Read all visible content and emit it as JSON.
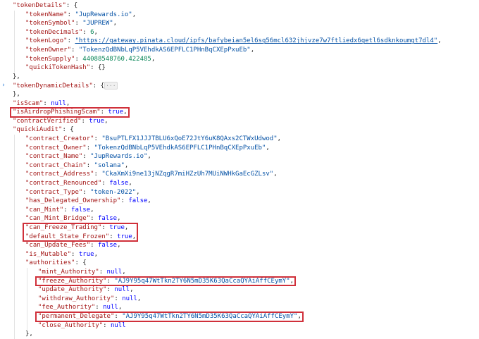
{
  "lines": [
    {
      "indent": 1,
      "toks": [
        [
          "k",
          "\"tokenDetails\""
        ],
        [
          "p",
          ": {"
        ]
      ]
    },
    {
      "indent": 2,
      "toks": [
        [
          "k",
          "\"tokenName\""
        ],
        [
          "p",
          ": "
        ],
        [
          "s",
          "\"JupRewards.io\""
        ],
        [
          "p",
          ","
        ]
      ]
    },
    {
      "indent": 2,
      "toks": [
        [
          "k",
          "\"tokenSymbol\""
        ],
        [
          "p",
          ": "
        ],
        [
          "s",
          "\"JUPREW\""
        ],
        [
          "p",
          ","
        ]
      ]
    },
    {
      "indent": 2,
      "toks": [
        [
          "k",
          "\"tokenDecimals\""
        ],
        [
          "p",
          ": "
        ],
        [
          "n",
          "6"
        ],
        [
          "p",
          ","
        ]
      ]
    },
    {
      "indent": 2,
      "toks": [
        [
          "k",
          "\"tokenLogo\""
        ],
        [
          "p",
          ": "
        ],
        [
          "u",
          "\"https://gateway.pinata.cloud/ipfs/bafybeian5el6sg56mcl632jhjvze7w7ftliedx6getl6sdknkoumgt7dl4\""
        ],
        [
          "p",
          ","
        ]
      ]
    },
    {
      "indent": 2,
      "toks": [
        [
          "k",
          "\"tokenOwner\""
        ],
        [
          "p",
          ": "
        ],
        [
          "s",
          "\"TokenzQdBNbLqP5VEhdkAS6EPFLC1PHnBqCXEpPxuEb\""
        ],
        [
          "p",
          ","
        ]
      ]
    },
    {
      "indent": 2,
      "toks": [
        [
          "k",
          "\"tokenSupply\""
        ],
        [
          "p",
          ": "
        ],
        [
          "n",
          "44088548760.422485"
        ],
        [
          "p",
          ","
        ]
      ]
    },
    {
      "indent": 2,
      "toks": [
        [
          "k",
          "\"quickiTokenHash\""
        ],
        [
          "p",
          ": {}"
        ]
      ]
    },
    {
      "indent": 1,
      "toks": [
        [
          "p",
          "},"
        ]
      ]
    },
    {
      "indent": 1,
      "fold": true,
      "toks": [
        [
          "k",
          "\"tokenDynamicDetails\""
        ],
        [
          "p",
          ": {"
        ],
        [
          "fc",
          "···"
        ]
      ]
    },
    {
      "indent": 1,
      "toks": [
        [
          "p",
          "},"
        ]
      ]
    },
    {
      "indent": 1,
      "toks": [
        [
          "k",
          "\"isScam\""
        ],
        [
          "p",
          ": "
        ],
        [
          "l",
          "null"
        ],
        [
          "p",
          ","
        ]
      ]
    },
    {
      "indent": 1,
      "toks": [
        [
          "k",
          "\"isAirdropPhishingScam\""
        ],
        [
          "p",
          ": "
        ],
        [
          "l",
          "true"
        ],
        [
          "p",
          ","
        ]
      ]
    },
    {
      "indent": 1,
      "toks": [
        [
          "k",
          "\"contractVerified\""
        ],
        [
          "p",
          ": "
        ],
        [
          "l",
          "true"
        ],
        [
          "p",
          ","
        ]
      ]
    },
    {
      "indent": 1,
      "toks": [
        [
          "k",
          "\"quickiAudit\""
        ],
        [
          "p",
          ": {"
        ]
      ]
    },
    {
      "indent": 2,
      "toks": [
        [
          "k",
          "\"contract_Creator\""
        ],
        [
          "p",
          ": "
        ],
        [
          "s",
          "\"BsuPTLFX1JJJTBLU6xQoE72JtY6uK8QAxs2CTWxUdwod\""
        ],
        [
          "p",
          ","
        ]
      ]
    },
    {
      "indent": 2,
      "toks": [
        [
          "k",
          "\"contract_Owner\""
        ],
        [
          "p",
          ": "
        ],
        [
          "s",
          "\"TokenzQdBNbLqP5VEhdkAS6EPFLC1PHnBqCXEpPxuEb\""
        ],
        [
          "p",
          ","
        ]
      ]
    },
    {
      "indent": 2,
      "toks": [
        [
          "k",
          "\"contract_Name\""
        ],
        [
          "p",
          ": "
        ],
        [
          "s",
          "\"JupRewards.io\""
        ],
        [
          "p",
          ","
        ]
      ]
    },
    {
      "indent": 2,
      "toks": [
        [
          "k",
          "\"contract_Chain\""
        ],
        [
          "p",
          ": "
        ],
        [
          "s",
          "\"solana\""
        ],
        [
          "p",
          ","
        ]
      ]
    },
    {
      "indent": 2,
      "toks": [
        [
          "k",
          "\"contract_Address\""
        ],
        [
          "p",
          ": "
        ],
        [
          "s",
          "\"CkaXmXi9ne13jNZqgR7miHZzUh7MUiNWHkGaEcGZLsv\""
        ],
        [
          "p",
          ","
        ]
      ]
    },
    {
      "indent": 2,
      "toks": [
        [
          "k",
          "\"contract_Renounced\""
        ],
        [
          "p",
          ": "
        ],
        [
          "l",
          "false"
        ],
        [
          "p",
          ","
        ]
      ]
    },
    {
      "indent": 2,
      "toks": [
        [
          "k",
          "\"contract_Type\""
        ],
        [
          "p",
          ": "
        ],
        [
          "s",
          "\"token-2022\""
        ],
        [
          "p",
          ","
        ]
      ]
    },
    {
      "indent": 2,
      "toks": [
        [
          "k",
          "\"has_Delegated_Ownership\""
        ],
        [
          "p",
          ": "
        ],
        [
          "l",
          "false"
        ],
        [
          "p",
          ","
        ]
      ]
    },
    {
      "indent": 2,
      "toks": [
        [
          "k",
          "\"can_Mint\""
        ],
        [
          "p",
          ": "
        ],
        [
          "l",
          "false"
        ],
        [
          "p",
          ","
        ]
      ]
    },
    {
      "indent": 2,
      "toks": [
        [
          "k",
          "\"can_Mint_Bridge\""
        ],
        [
          "p",
          ": "
        ],
        [
          "l",
          "false"
        ],
        [
          "p",
          ","
        ]
      ]
    },
    {
      "indent": 2,
      "toks": [
        [
          "k",
          "\"can_Freeze_Trading\""
        ],
        [
          "p",
          ": "
        ],
        [
          "l",
          "true"
        ],
        [
          "p",
          ","
        ]
      ]
    },
    {
      "indent": 2,
      "toks": [
        [
          "k",
          "\"default_State_Frozen\""
        ],
        [
          "p",
          ": "
        ],
        [
          "l",
          "true"
        ],
        [
          "p",
          ","
        ]
      ]
    },
    {
      "indent": 2,
      "toks": [
        [
          "k",
          "\"can_Update_Fees\""
        ],
        [
          "p",
          ": "
        ],
        [
          "l",
          "false"
        ],
        [
          "p",
          ","
        ]
      ]
    },
    {
      "indent": 2,
      "toks": [
        [
          "k",
          "\"is_Mutable\""
        ],
        [
          "p",
          ": "
        ],
        [
          "l",
          "true"
        ],
        [
          "p",
          ","
        ]
      ]
    },
    {
      "indent": 2,
      "toks": [
        [
          "k",
          "\"authorities\""
        ],
        [
          "p",
          ": {"
        ]
      ]
    },
    {
      "indent": 3,
      "toks": [
        [
          "k",
          "\"mint_Authority\""
        ],
        [
          "p",
          ": "
        ],
        [
          "l",
          "null"
        ],
        [
          "p",
          ","
        ]
      ]
    },
    {
      "indent": 3,
      "toks": [
        [
          "k",
          "\"freeze_Authority\""
        ],
        [
          "p",
          ": "
        ],
        [
          "s",
          "\"AJ9Y95q47WtTkn2TY6N5mD35K63QaCcaQYAiAffCEymY\""
        ],
        [
          "p",
          ","
        ]
      ]
    },
    {
      "indent": 3,
      "toks": [
        [
          "k",
          "\"update_Authority\""
        ],
        [
          "p",
          ": "
        ],
        [
          "l",
          "null"
        ],
        [
          "p",
          ","
        ]
      ]
    },
    {
      "indent": 3,
      "toks": [
        [
          "k",
          "\"withdraw_Authority\""
        ],
        [
          "p",
          ": "
        ],
        [
          "l",
          "null"
        ],
        [
          "p",
          ","
        ]
      ]
    },
    {
      "indent": 3,
      "toks": [
        [
          "k",
          "\"fee_Authority\""
        ],
        [
          "p",
          ": "
        ],
        [
          "l",
          "null"
        ],
        [
          "p",
          ","
        ]
      ]
    },
    {
      "indent": 3,
      "toks": [
        [
          "k",
          "\"permanent_Delegate\""
        ],
        [
          "p",
          ": "
        ],
        [
          "s",
          "\"AJ9Y95q47WtTkn2TY6N5mD35K63QaCcaQYAiAffCEymY\""
        ],
        [
          "p",
          ","
        ]
      ]
    },
    {
      "indent": 3,
      "toks": [
        [
          "k",
          "\"close_Authority\""
        ],
        [
          "p",
          ": "
        ],
        [
          "l",
          "null"
        ]
      ]
    },
    {
      "indent": 2,
      "toks": [
        [
          "p",
          "},"
        ]
      ]
    }
  ],
  "highlights": [
    {
      "from": 12,
      "to": 12
    },
    {
      "from": 25,
      "to": 26
    },
    {
      "from": 31,
      "to": 31
    },
    {
      "from": 35,
      "to": 35
    }
  ],
  "colors": {
    "key": "#a31515",
    "string": "#0451a5",
    "number": "#098658",
    "literal": "#0000ff",
    "highlight_box": "#d0303a"
  },
  "icons": {
    "fold_arrow": "chevron-right-icon"
  }
}
